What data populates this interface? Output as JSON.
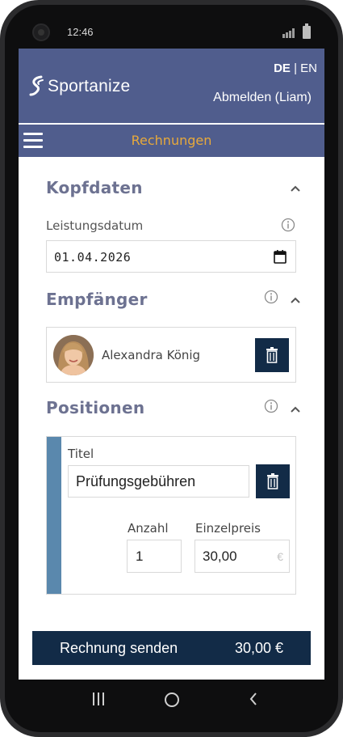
{
  "status": {
    "time": "12:46"
  },
  "header": {
    "brand": "Sportanize",
    "lang_de": "DE",
    "lang_sep": " | ",
    "lang_en": "EN",
    "logout": "Abmelden (Liam)"
  },
  "nav": {
    "title": "Rechnungen"
  },
  "kopfdaten": {
    "title": "Kopfdaten",
    "date_label": "Leistungsdatum",
    "date_value": "01.04.2026"
  },
  "empfaenger": {
    "title": "Empfänger",
    "name": "Alexandra König"
  },
  "positionen": {
    "title": "Positionen",
    "items": [
      {
        "title_label": "Titel",
        "title_value": "Prüfungsgebühren",
        "quantity_label": "Anzahl",
        "quantity_value": "1",
        "price_label": "Einzelpreis",
        "price_value": "30,00",
        "currency": "€"
      }
    ]
  },
  "footer": {
    "send_label": "Rechnung senden",
    "total": "30,00 €"
  },
  "colors": {
    "header_bg": "#505d8d",
    "nav_title": "#e7a93b",
    "primary_dark": "#122b47",
    "section_title": "#6d7291",
    "position_stripe": "#5a88ad"
  },
  "icons": [
    "menu-icon",
    "chevron-up-icon",
    "info-icon",
    "calendar-icon",
    "trash-icon",
    "recents-icon",
    "home-icon",
    "back-icon"
  ]
}
